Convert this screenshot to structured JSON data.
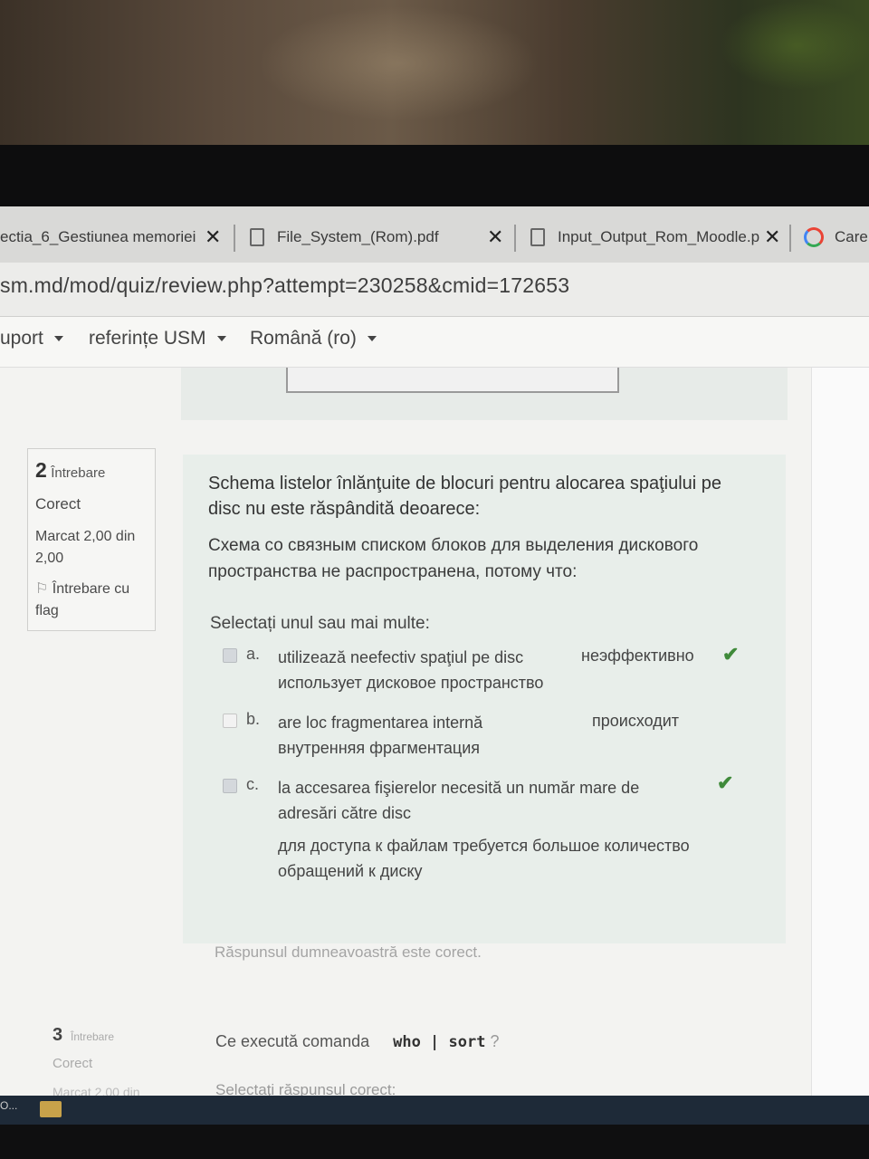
{
  "browser": {
    "tabs": [
      {
        "label": "ectia_6_Gestiunea memoriei",
        "close": "✕"
      },
      {
        "label": "File_System_(Rom).pdf",
        "close": "✕"
      },
      {
        "label": "Input_Output_Rom_Moodle.p",
        "close": "✕"
      },
      {
        "label": "Care"
      }
    ],
    "url": "sm.md/mod/quiz/review.php?attempt=230258&cmid=172653"
  },
  "nav": {
    "items": [
      "uport",
      "referințe USM",
      "Română (ro)"
    ]
  },
  "question2": {
    "number": "2",
    "number_label": "Întrebare",
    "state": "Corect",
    "grade": "Marcat 2,00 din 2,00",
    "flag_label": "Întrebare cu flag",
    "text_ro": "Schema listelor înlănţuite de blocuri pentru alocarea spaţiului pe disc nu este răspândită deoarece:",
    "text_ru": "Схема со связным списком блоков для выделения дискового пространства не распространена, потому что:",
    "prompt": "Selectați unul sau mai multe:",
    "answers": [
      {
        "letter": "a.",
        "text": "utilizează neefectiv spaţiul pe disc",
        "note": "неэффективно",
        "text_ru": "использует дисковое пространство",
        "checked": true,
        "correct_mark": "✔"
      },
      {
        "letter": "b.",
        "text": "are loc fragmentarea internă",
        "note": "происходит",
        "text_ru": "внутренняя фрагментация",
        "checked": false,
        "correct_mark": ""
      },
      {
        "letter": "c.",
        "text": "la accesarea fişierelor necesită un număr mare de adresări către disc",
        "note": "",
        "text_ru": "для доступа к файлам требуется большое количество обращений к диску",
        "checked": true,
        "correct_mark": "✔"
      }
    ],
    "feedback": "Răspunsul dumneavoastră este corect."
  },
  "question3": {
    "number": "3",
    "number_label": "Întrebare",
    "state": "Corect",
    "grade": "Marcat 2,00 din",
    "text": "Ce execută comanda",
    "command": "who | sort",
    "qmark": "?",
    "prompt": "Selectaţi răspunsul corect:"
  },
  "taskbar": {
    "item": "O..."
  },
  "colors": {
    "correct_tick": "#3f8a3a",
    "question_bg": "#e8eeea"
  }
}
